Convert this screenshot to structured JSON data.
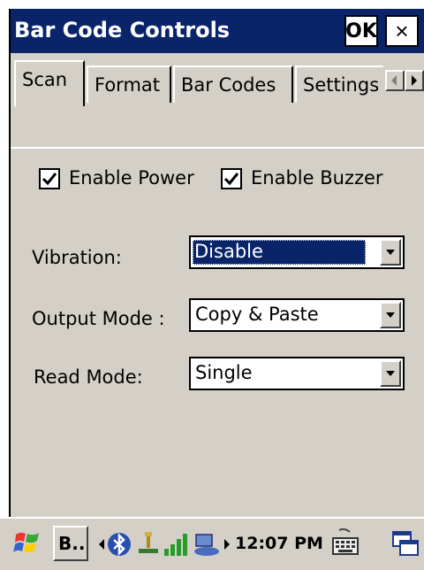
{
  "window": {
    "title": "Bar Code Controls",
    "ok_label": "OK",
    "close_label": "×"
  },
  "tabs": [
    {
      "label": "Scan",
      "active": true
    },
    {
      "label": "Format",
      "active": false
    },
    {
      "label": "Bar Codes",
      "active": false
    },
    {
      "label": "Settings",
      "active": false
    }
  ],
  "checkboxes": {
    "enable_power": {
      "label": "Enable Power",
      "checked": true
    },
    "enable_buzzer": {
      "label": "Enable Buzzer",
      "checked": true
    }
  },
  "fields": {
    "vibration": {
      "label": "Vibration:",
      "value": "Disable"
    },
    "output_mode": {
      "label": "Output Mode :",
      "value": "Copy & Paste"
    },
    "read_mode": {
      "label": "Read Mode:",
      "value": "Single"
    }
  },
  "taskbar": {
    "task_label": "B..",
    "clock": "12:07 PM"
  },
  "colors": {
    "titlebar": "#0a246a",
    "face": "#d4d0c8",
    "selection": "#0a246a"
  },
  "icons": [
    "start-flag-icon",
    "bluetooth-icon",
    "usb-icon",
    "signal-icon",
    "network-icon",
    "keyboard-icon",
    "windows-icon",
    "close-icon",
    "check-icon",
    "chevron-down-icon"
  ]
}
